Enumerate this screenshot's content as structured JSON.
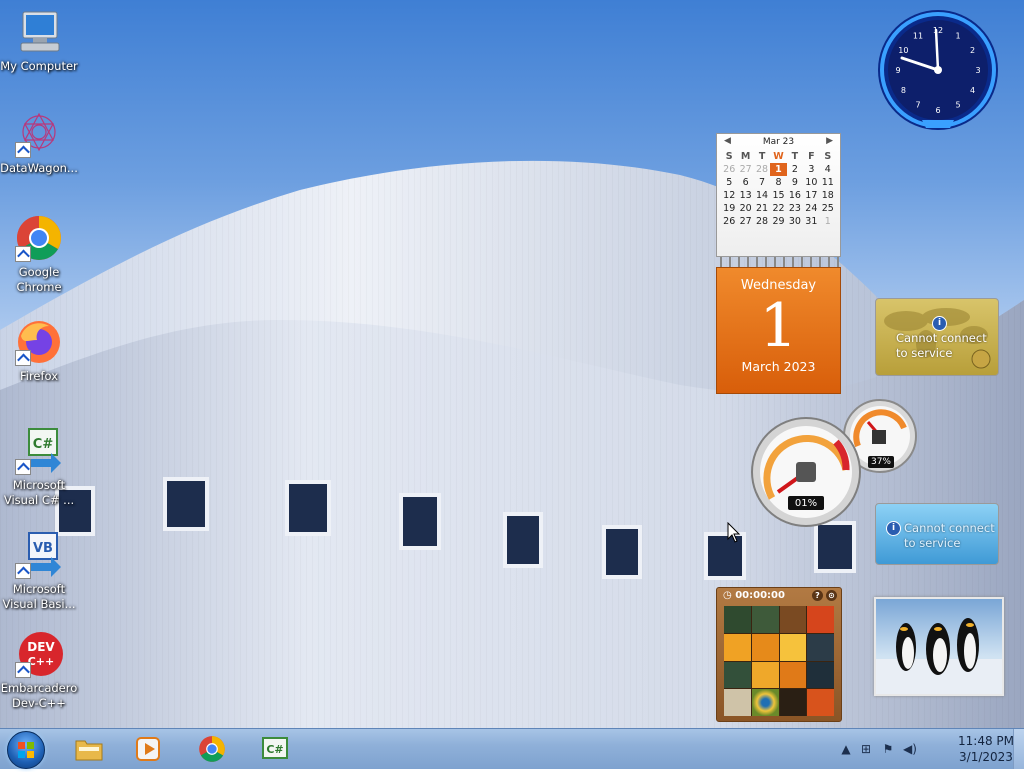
{
  "desktop": {
    "icons": [
      {
        "label": "My Computer",
        "icon": "computer-icon"
      },
      {
        "label": "DataWagon...",
        "icon": "datawagon-icon"
      },
      {
        "label": "Google Chrome",
        "icon": "chrome-icon"
      },
      {
        "label": "Firefox",
        "icon": "firefox-icon"
      },
      {
        "label": "Microsoft Visual C# ...",
        "icon": "visual-csharp-icon"
      },
      {
        "label": "Microsoft Visual Basi...",
        "icon": "visual-basic-icon"
      },
      {
        "label": "Embarcadero Dev-C++",
        "icon": "devcpp-icon"
      }
    ]
  },
  "gadgets": {
    "calendar": {
      "month_label": "Mar 23",
      "weekdays": [
        "S",
        "M",
        "T",
        "W",
        "T",
        "F",
        "S"
      ],
      "today_weekday_index": 3,
      "weeks": [
        [
          "26",
          "27",
          "28",
          "1",
          "2",
          "3",
          "4"
        ],
        [
          "5",
          "6",
          "7",
          "8",
          "9",
          "10",
          "11"
        ],
        [
          "12",
          "13",
          "14",
          "15",
          "16",
          "17",
          "18"
        ],
        [
          "19",
          "20",
          "21",
          "22",
          "23",
          "24",
          "25"
        ],
        [
          "26",
          "27",
          "28",
          "29",
          "30",
          "31",
          "1"
        ]
      ],
      "weekday_name": "Wednesday",
      "day_number": "1",
      "month_year": "March 2023"
    },
    "currency": {
      "message": "Cannot connect to service",
      "info_icon": "i"
    },
    "weather": {
      "message": "Cannot connect to service",
      "info_icon": "i"
    },
    "cpu_meter": {
      "cpu_percent": "01%",
      "memory_percent": "37%"
    },
    "puzzle": {
      "timer": "00:00:00"
    },
    "clock": {
      "numbers": [
        "12",
        "1",
        "2",
        "3",
        "4",
        "5",
        "6",
        "7",
        "8",
        "9",
        "10",
        "11"
      ]
    }
  },
  "taskbar": {
    "pinned": [
      {
        "name": "explorer",
        "icon": "folder-icon"
      },
      {
        "name": "media-player",
        "icon": "media-player-icon"
      },
      {
        "name": "chrome",
        "icon": "chrome-icon"
      },
      {
        "name": "visual-csharp",
        "icon": "visual-csharp-icon"
      }
    ],
    "tray": {
      "time": "11:48 PM",
      "date": "3/1/2023"
    }
  },
  "colors": {
    "calendar_accent": "#e0641c",
    "taskbar": "#8fb0d9"
  }
}
